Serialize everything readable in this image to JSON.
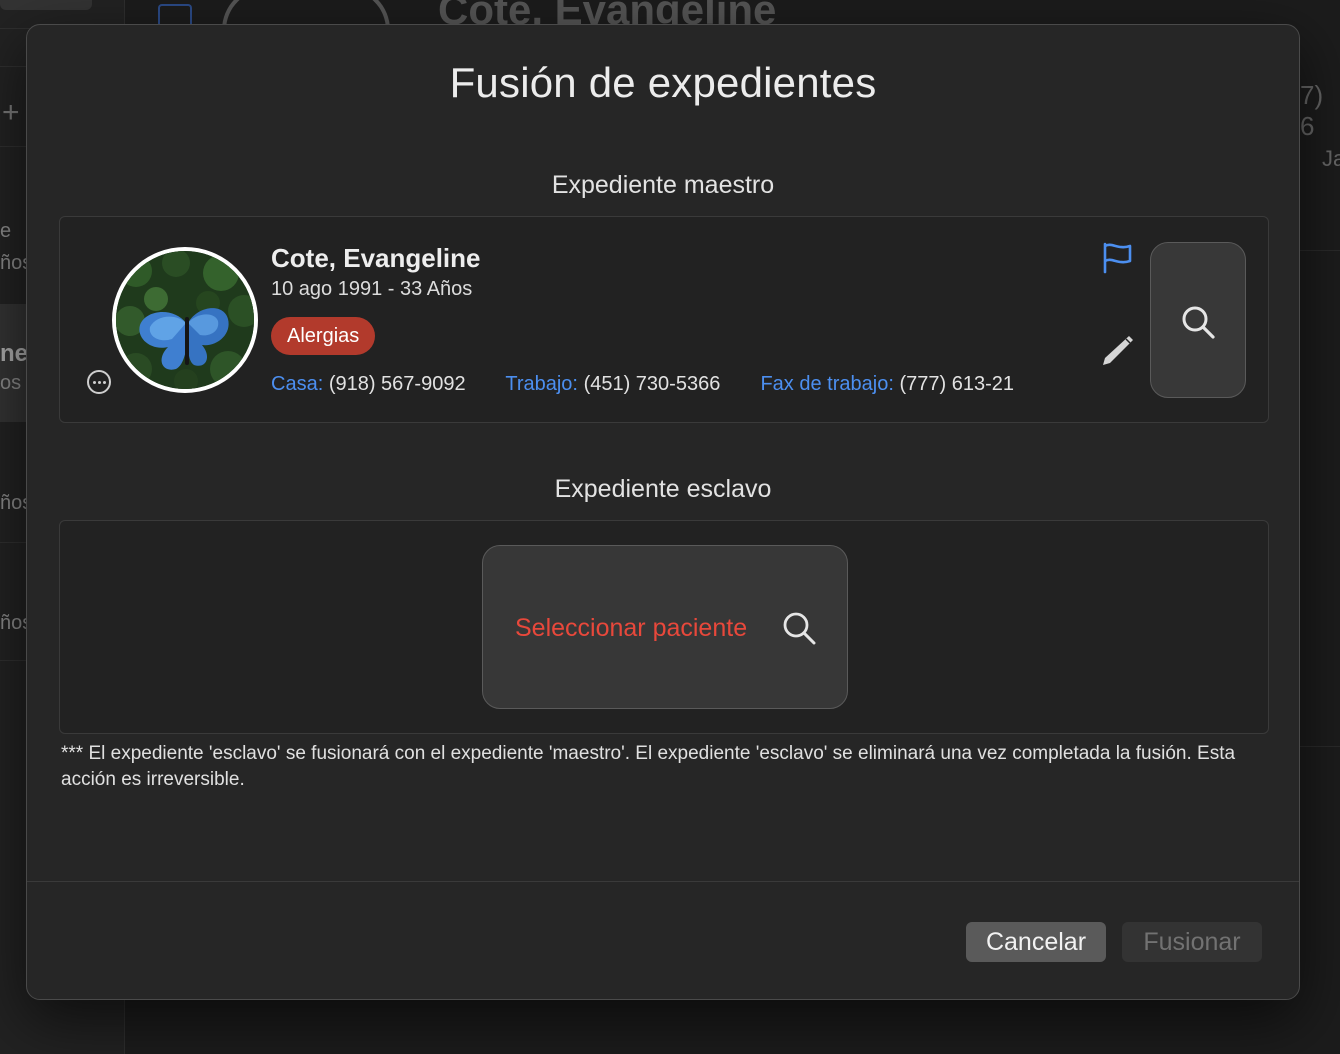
{
  "background": {
    "title": "Cote, Evangeline",
    "phone_fragment": "7) 6",
    "side_fragment": "Ja",
    "sidebar_fragments": [
      "e",
      "ños",
      "ne",
      "os",
      "ños",
      "ños"
    ]
  },
  "dialog": {
    "title": "Fusión de expedientes",
    "master_heading": "Expediente maestro",
    "slave_heading": "Expediente esclavo",
    "master": {
      "name": "Cote, Evangeline",
      "dob_age": "10 ago 1991 - 33 Años",
      "badge": "Alergias",
      "phones": [
        {
          "label": "Casa:",
          "value": "(918) 567-9092"
        },
        {
          "label": "Trabajo:",
          "value": "(451) 730-5366"
        },
        {
          "label": "Fax de trabajo:",
          "value": "(777) 613-21"
        }
      ],
      "icons": [
        "more-icon",
        "flag-icon",
        "pencil-icon",
        "search-icon"
      ]
    },
    "slave": {
      "select_label": "Seleccionar paciente"
    },
    "note": "*** El expediente 'esclavo' se fusionará con el expediente 'maestro'. El expediente 'esclavo' se eliminará una vez completada la fusión. Esta acción es irreversible.",
    "buttons": {
      "cancel": "Cancelar",
      "merge": "Fusionar"
    }
  },
  "colors": {
    "accent_blue": "#4c8ff0",
    "badge_red": "#b23a2c",
    "select_red": "#e8483b"
  }
}
